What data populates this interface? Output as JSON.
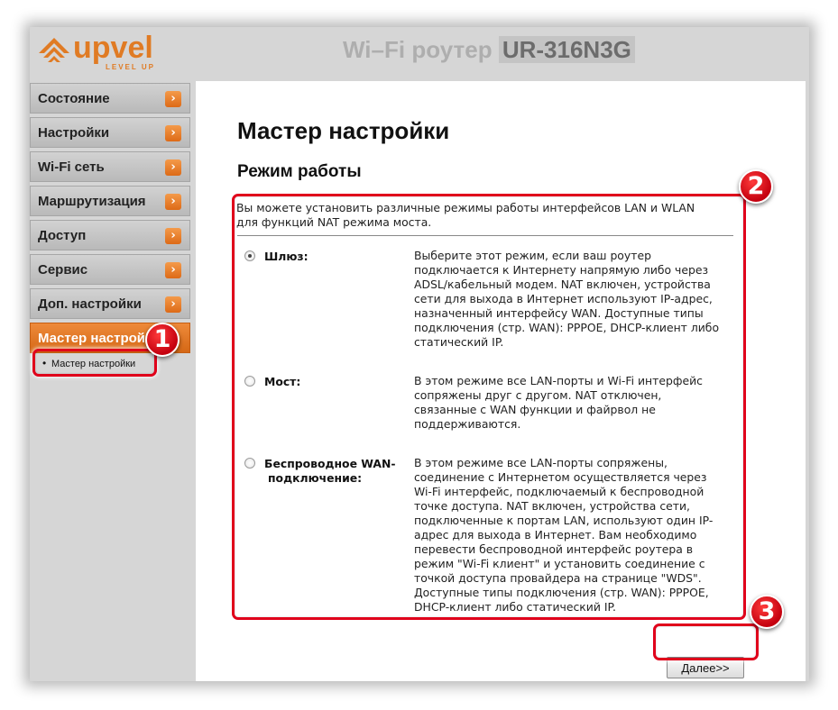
{
  "header": {
    "logo_text": "upvel",
    "logo_tagline": "LEVEL UP",
    "product_prefix": "Wi–Fi роутер",
    "product_model": "UR-316N3G"
  },
  "sidebar": {
    "items": [
      {
        "label": "Состояние",
        "active": false
      },
      {
        "label": "Настройки",
        "active": false
      },
      {
        "label": "Wi-Fi сеть",
        "active": false
      },
      {
        "label": "Маршрутизация",
        "active": false
      },
      {
        "label": "Доступ",
        "active": false
      },
      {
        "label": "Сервис",
        "active": false
      },
      {
        "label": "Доп. настройки",
        "active": false
      },
      {
        "label": "Мастер настройки",
        "active": true
      }
    ],
    "submenu": [
      "Мастер настройки"
    ]
  },
  "main": {
    "page_title": "Мастер настройки",
    "section_title": "Режим работы",
    "intro_line1": "Вы можете установить различные режимы работы интерфейсов LAN и WLAN",
    "intro_line2": "для функций NAT режима моста.",
    "options": [
      {
        "label": "Шлюз:",
        "checked": true,
        "description": "Выберите этот режим, если ваш роутер подключается к Интернету напрямую либо через ADSL/кабельный модем. NAT включен, устройства сети для выхода в Интернет используют IP-адрес, назначенный интерфейсу WAN. Доступные типы подключения (стр. WAN): PPPOE, DHCP-клиент либо статический IP."
      },
      {
        "label": "Мост:",
        "checked": false,
        "description": "В этом режиме все LAN-порты и Wi-Fi интерфейс сопряжены друг с другом. NAT отключен, связанные с WAN функции и файрвол не поддерживаются."
      },
      {
        "label_line1": "Беспроводное WAN-",
        "label_line2": "подключение:",
        "checked": false,
        "description": "В этом режиме все LAN-порты сопряжены, соединение с Интернетом осуществляется через Wi-Fi интерфейс, подключаемый к беспроводной точке доступа. NAT включен, устройства сети, подключенные к портам LAN, используют один IP-адрес для выхода в Интернет. Вам необходимо перевести беспроводной интерфейс роутера в режим \"Wi-Fi клиент\" и установить соединение с точкой доступа провайдера на странице \"WDS\". Доступные типы подключения (стр. WAN): PPPOE, DHCP-клиент либо статический IP."
      }
    ],
    "next_button": "Далее>>"
  },
  "annotations": {
    "badges": [
      "1",
      "2",
      "3"
    ],
    "highlight_color": "#e0001b"
  },
  "colors": {
    "accent": "#e07b24",
    "menu_active": "#d56816"
  }
}
